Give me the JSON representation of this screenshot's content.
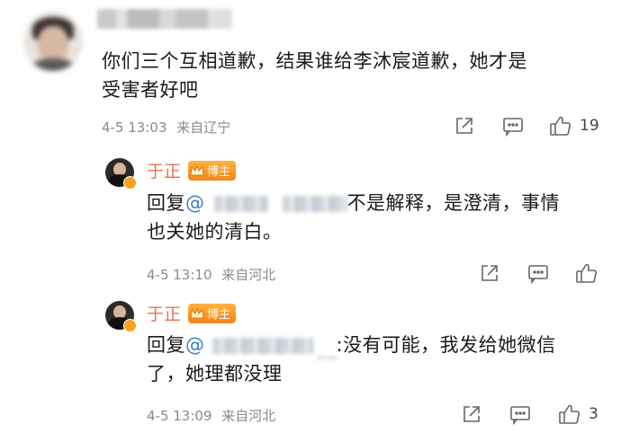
{
  "comment": {
    "text_line1": "你们三个互相道歉，结果谁给李沐宸道歉，她才是",
    "text_line2": "受害者好吧",
    "time": "4-5 13:03",
    "location": "来自辽宁",
    "like_count": "19"
  },
  "replies": [
    {
      "author": "于正",
      "badge": "博主",
      "prefix": "回复",
      "at": "@",
      "text_line1_tail": "不是解释，是澄清，事情",
      "text_line2": "也关她的清白。",
      "time": "4-5 13:10",
      "location": "来自河北",
      "like_count": ""
    },
    {
      "author": "于正",
      "badge": "博主",
      "prefix": "回复",
      "at": "@",
      "text_line1_tail": ":没有可能，我发给她微信",
      "text_line2": "了，她理都没理",
      "time": "4-5 13:09",
      "location": "来自河北",
      "like_count": "3"
    }
  ],
  "icons": [
    "share-icon",
    "comment-icon",
    "like-icon",
    "crown-icon",
    "verified-badge-icon"
  ],
  "colors": {
    "link": "#3f7cc4",
    "author": "#eb7350",
    "badge": "#f2861c",
    "meta": "#8a8a8a"
  }
}
